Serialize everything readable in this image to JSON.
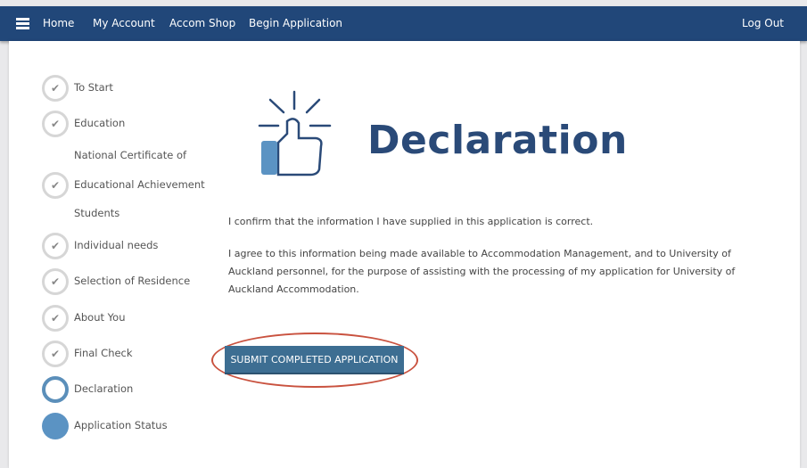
{
  "nav": {
    "items": [
      "Home",
      "My Account",
      "Accom Shop",
      "Begin Application"
    ],
    "logout": "Log Out"
  },
  "steps": [
    {
      "label": "To Start",
      "state": "done"
    },
    {
      "label": "Education",
      "state": "done"
    },
    {
      "label": "National Certificate of",
      "state": "text"
    },
    {
      "label": "Educational Achievement",
      "state": "done"
    },
    {
      "label": "Students",
      "state": "text"
    },
    {
      "label": "Individual needs",
      "state": "done"
    },
    {
      "label": "Selection of Residence",
      "state": "done"
    },
    {
      "label": "About You",
      "state": "done"
    },
    {
      "label": "Final Check",
      "state": "done"
    },
    {
      "label": "Declaration",
      "state": "current"
    },
    {
      "label": "Application Status",
      "state": "future"
    }
  ],
  "main": {
    "title": "Declaration",
    "icon": "thumbs-up-icon",
    "para1": "I confirm that the information I have supplied in this application is correct.",
    "para2": "I agree to this information being made available to Accommodation Management, and to University of Auckland personnel, for the purpose of assisting with the processing of my application for University of Auckland Accommodation.",
    "submit": "SUBMIT COMPLETED APPLICATION"
  },
  "colors": {
    "nav": "#214779",
    "accent": "#5b93c3",
    "button": "#3d6e92",
    "highlight": "#c9523f"
  }
}
